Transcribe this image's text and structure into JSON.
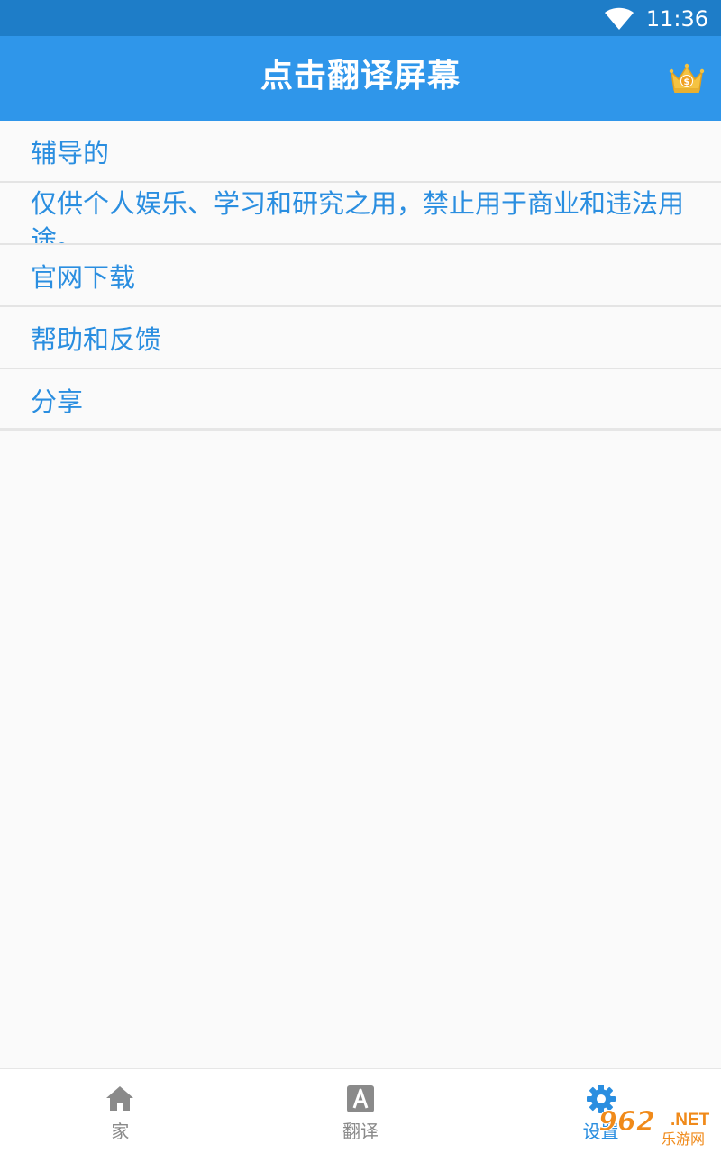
{
  "status_bar": {
    "time": "11:36",
    "wifi_icon": "wifi-icon"
  },
  "app_bar": {
    "title": "点击翻译屏幕",
    "vip_icon": "crown-icon",
    "vip_colors": {
      "crown": "#f5c342",
      "coin": "#f0a020"
    }
  },
  "menu": {
    "items": [
      {
        "label": "辅导的"
      },
      {
        "label": "仅供个人娱乐、学习和研究之用，禁止用于商业和违法用途。"
      },
      {
        "label": "官网下载"
      },
      {
        "label": "帮助和反馈"
      },
      {
        "label": "分享"
      }
    ]
  },
  "bottom_nav": {
    "items": [
      {
        "label": "家",
        "icon": "home-icon"
      },
      {
        "label": "翻译",
        "icon": "translate-icon"
      },
      {
        "label": "设置",
        "icon": "gear-icon"
      }
    ],
    "active_index": 2
  },
  "watermark": {
    "logo": "962",
    "suffix": ".NET",
    "sub": "乐游网"
  },
  "colors": {
    "status_bar": "#1e7dc8",
    "app_bar": "#2f96ea",
    "accent": "#2a8ee0",
    "inactive": "#8a8a8a",
    "background": "#fafafa"
  }
}
